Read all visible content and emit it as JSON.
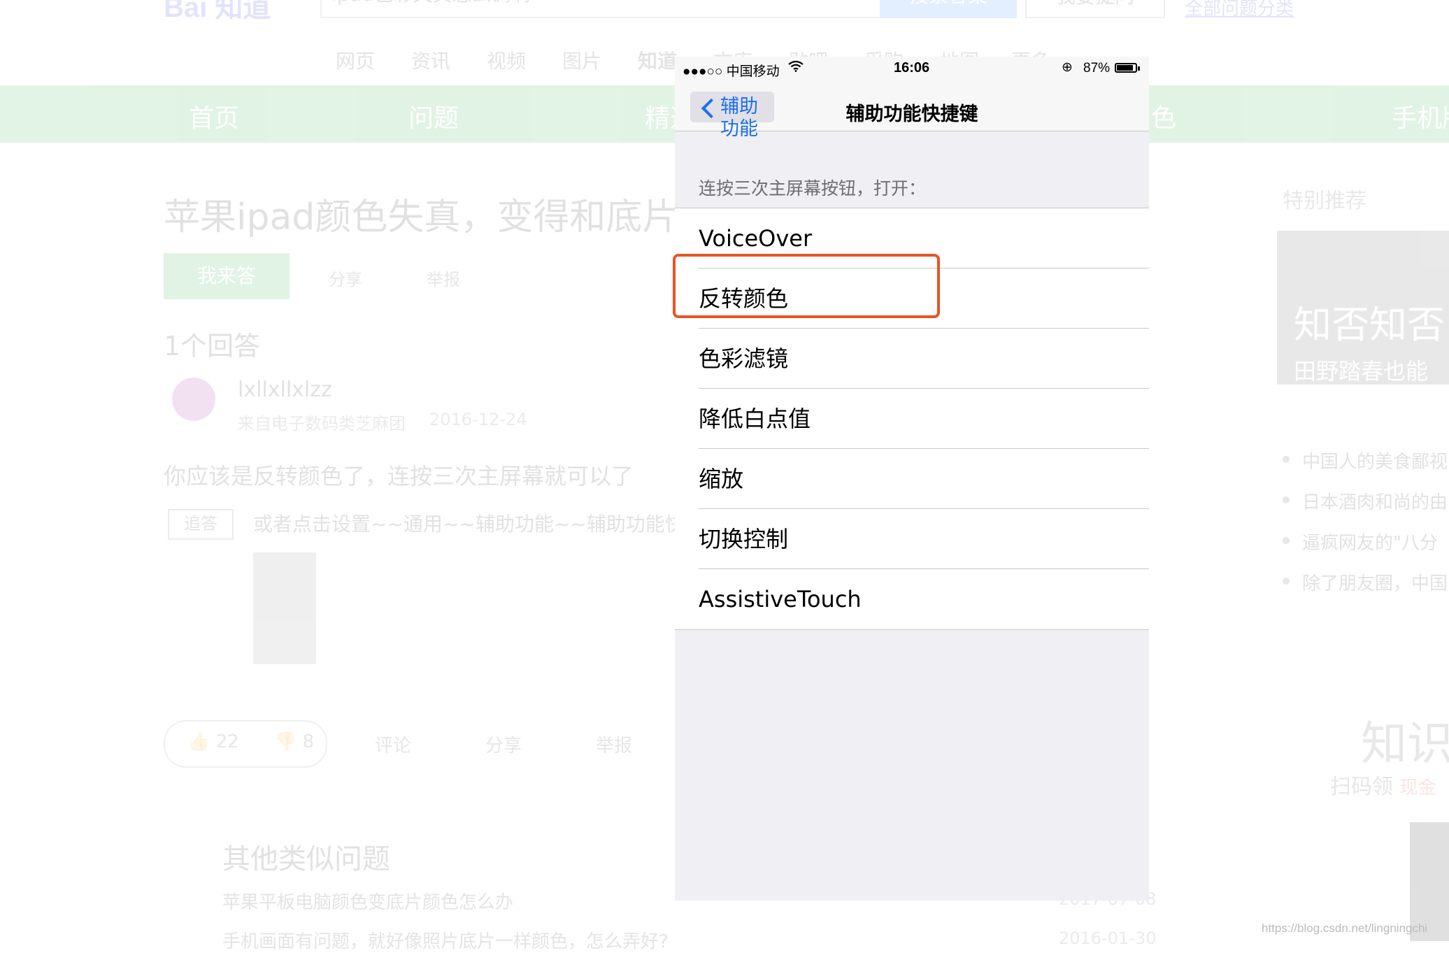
{
  "background": {
    "logo": "Bai 知道",
    "search_value": "ipad色彩失真怎么调啊",
    "search_button": "搜索答案",
    "ask_button": "我要提问",
    "top_link": "全部问题分类",
    "nav_tabs": [
      "网页",
      "资讯",
      "视频",
      "图片",
      "知道",
      "文库",
      "贴吧",
      "采购",
      "地图",
      "更多"
    ],
    "green_nav": [
      "首页",
      "问题",
      "精选",
      "色",
      "手机版"
    ],
    "question_title": "苹果ipad颜色失真，变得和底片一样",
    "answer_button": "我来答",
    "share": "分享",
    "report": "举报",
    "answer_count": "1个回答",
    "answerer": "lxllxllxlzz",
    "answerer_sub": "来自电子数码类芝麻团",
    "answer_date": "2016-12-24",
    "answer_text": "你应该是反转颜色了，连按三次主屏幕就可以了",
    "followup_tag": "追答",
    "followup_text": "或者点击设置~~通用~~辅助功能~~辅助功能快捷键",
    "like_count": "22",
    "dislike_count": "8",
    "comment": "评论",
    "similar_heading": "其他类似问题",
    "similar_questions": [
      {
        "text": "苹果平板电脑颜色变底片颜色怎么办",
        "date": "2017-07-08"
      },
      {
        "text": "手机画面有问题，就好像照片底片一样颜色，怎么弄好?",
        "date": "2016-01-30"
      }
    ],
    "right_heading": "特别推荐",
    "right_banner_title": "知否知否",
    "right_banner_sub": "田野踏春也能",
    "right_items": [
      "中国人的美食鄙视",
      "日本酒肉和尚的由",
      "逼疯网友的\"八分",
      "除了朋友圈，中国"
    ],
    "right_know": "知识",
    "right_scan": "扫码领",
    "right_scan_tag": "现金"
  },
  "phone": {
    "status": {
      "carrier": "●●●○○ 中国移动",
      "time": "16:06",
      "battery_pct": "87%",
      "battery_level": 0.87
    },
    "nav": {
      "back_label": "辅助功能",
      "title": "辅助功能快捷键"
    },
    "section_header": "连按三次主屏幕按钮，打开：",
    "options": [
      "VoiceOver",
      "反转颜色",
      "色彩滤镜",
      "降低白点值",
      "缩放",
      "切换控制",
      "AssistiveTouch"
    ]
  },
  "watermark": "https://blog.csdn.net/lingningchi",
  "colors": {
    "ios_blue": "#1c6ef2",
    "highlight": "#e85424",
    "baidu_green": "#22a83a"
  }
}
